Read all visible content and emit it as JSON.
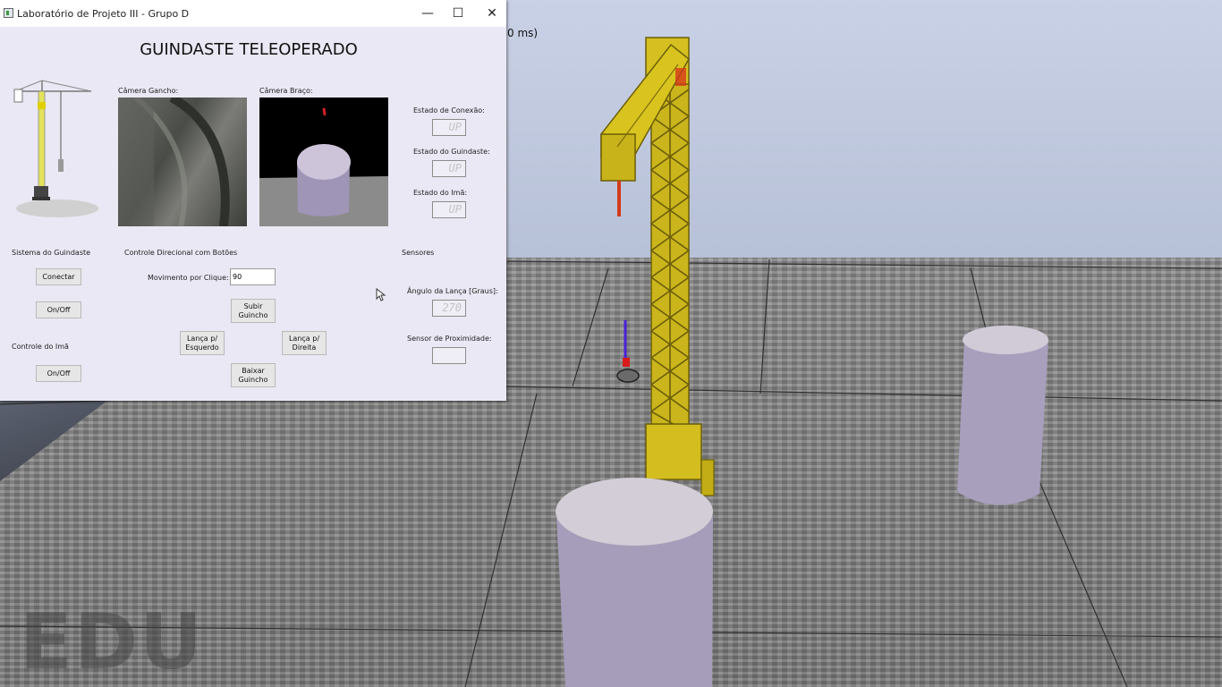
{
  "window": {
    "title": "Laboratório de Projeto III - Grupo D",
    "minimize_glyph": "—",
    "maximize_glyph": "☐",
    "close_glyph": "✕"
  },
  "heading": "GUINDASTE TELEOPERADO",
  "cameras": {
    "hook_label": "Câmera Gancho:",
    "arm_label": "Câmera Braço:"
  },
  "status": {
    "connection_label": "Estado de Conexão:",
    "connection_value": "UP",
    "crane_label": "Estado do Guindaste:",
    "crane_value": "UP",
    "magnet_label": "Estado do Imã:",
    "magnet_value": "UP"
  },
  "crane_system": {
    "label": "Sistema do Guindaste",
    "connect_button": "Conectar",
    "onoff_button": "On/Off"
  },
  "magnet_control": {
    "label": "Controle do Imã",
    "onoff_button": "On/Off"
  },
  "directional": {
    "label": "Controle Direcional com Botões",
    "move_label": "Movimento por Clique:",
    "move_value": "90",
    "raise_line1": "Subir",
    "raise_line2": "Guincho",
    "left_line1": "Lança p/",
    "left_line2": "Esquerdo",
    "right_line1": "Lança p/",
    "right_line2": "Direita",
    "lower_line1": "Baixar",
    "lower_line2": "Guincho"
  },
  "sensors": {
    "label": "Sensores",
    "boom_angle_label": "Ângulo da Lança [Graus]:",
    "boom_angle_value": "270",
    "proximity_label": "Sensor de Proximidade:",
    "proximity_value": ""
  },
  "scene": {
    "timing_text": "0 ms)",
    "watermark": "EDU"
  },
  "colors": {
    "window_bg": "#eae8f4",
    "crane_yellow": "#d8c21c",
    "cylinder": "#a89fbd",
    "floor": "#838383",
    "sky": "#c2cbe0"
  },
  "icons": [
    "app-icon",
    "crane-illustration-icon",
    "mouse-cursor-icon"
  ]
}
